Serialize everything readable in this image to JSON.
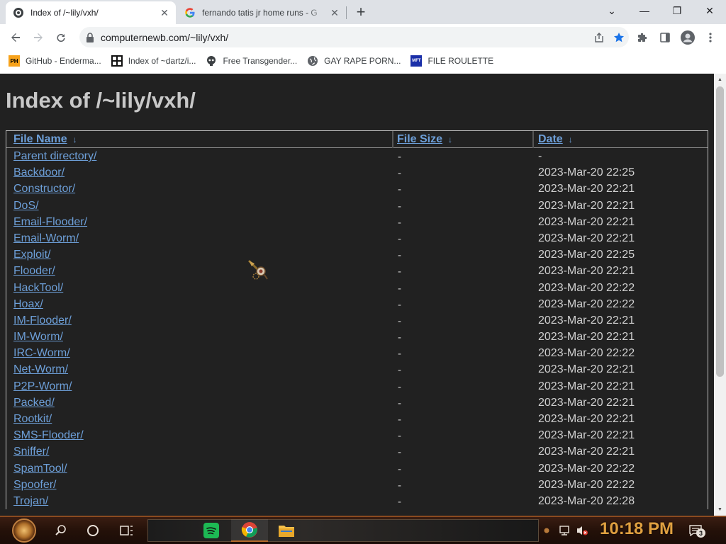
{
  "browser": {
    "tabs": [
      {
        "title": "Index of /~lily/vxh/",
        "active": true
      },
      {
        "title": "fernando tatis jr home runs - G",
        "active": false
      }
    ],
    "url": "computernewb.com/~lily/vxh/",
    "bookmarks": [
      {
        "label": "GitHub - Enderma...",
        "icon": "PH"
      },
      {
        "label": "Index of ~dartz/i...",
        "icon": "grid"
      },
      {
        "label": "Free Transgender...",
        "icon": "skull"
      },
      {
        "label": "GAY RAPE PORN...",
        "icon": "globe"
      },
      {
        "label": "FILE ROULETTE",
        "icon": "MFT"
      }
    ]
  },
  "page": {
    "heading": "Index of /~lily/vxh/",
    "columns": {
      "name": "File Name",
      "size": "File Size",
      "date": "Date",
      "sort_arrow": "↓"
    },
    "rows": [
      {
        "name": "Parent directory/",
        "size": "-",
        "date": "-"
      },
      {
        "name": "Backdoor/",
        "size": "-",
        "date": "2023-Mar-20 22:25"
      },
      {
        "name": "Constructor/",
        "size": "-",
        "date": "2023-Mar-20 22:21"
      },
      {
        "name": "DoS/",
        "size": "-",
        "date": "2023-Mar-20 22:21"
      },
      {
        "name": "Email-Flooder/",
        "size": "-",
        "date": "2023-Mar-20 22:21"
      },
      {
        "name": "Email-Worm/",
        "size": "-",
        "date": "2023-Mar-20 22:21"
      },
      {
        "name": "Exploit/",
        "size": "-",
        "date": "2023-Mar-20 22:25"
      },
      {
        "name": "Flooder/",
        "size": "-",
        "date": "2023-Mar-20 22:21"
      },
      {
        "name": "HackTool/",
        "size": "-",
        "date": "2023-Mar-20 22:22"
      },
      {
        "name": "Hoax/",
        "size": "-",
        "date": "2023-Mar-20 22:22"
      },
      {
        "name": "IM-Flooder/",
        "size": "-",
        "date": "2023-Mar-20 22:21"
      },
      {
        "name": "IM-Worm/",
        "size": "-",
        "date": "2023-Mar-20 22:21"
      },
      {
        "name": "IRC-Worm/",
        "size": "-",
        "date": "2023-Mar-20 22:22"
      },
      {
        "name": "Net-Worm/",
        "size": "-",
        "date": "2023-Mar-20 22:21"
      },
      {
        "name": "P2P-Worm/",
        "size": "-",
        "date": "2023-Mar-20 22:21"
      },
      {
        "name": "Packed/",
        "size": "-",
        "date": "2023-Mar-20 22:21"
      },
      {
        "name": "Rootkit/",
        "size": "-",
        "date": "2023-Mar-20 22:21"
      },
      {
        "name": "SMS-Flooder/",
        "size": "-",
        "date": "2023-Mar-20 22:21"
      },
      {
        "name": "Sniffer/",
        "size": "-",
        "date": "2023-Mar-20 22:21"
      },
      {
        "name": "SpamTool/",
        "size": "-",
        "date": "2023-Mar-20 22:22"
      },
      {
        "name": "Spoofer/",
        "size": "-",
        "date": "2023-Mar-20 22:22"
      },
      {
        "name": "Trojan/",
        "size": "-",
        "date": "2023-Mar-20 22:28"
      }
    ]
  },
  "taskbar": {
    "time": "10:18 PM",
    "notification_count": "3",
    "apps": [
      "spotify",
      "chrome",
      "file-explorer"
    ]
  },
  "colors": {
    "page_bg": "#212121",
    "link": "#6d9fd8",
    "heading": "#c8c8c8",
    "clock": "#e0a040",
    "taskbar": "#241109"
  }
}
